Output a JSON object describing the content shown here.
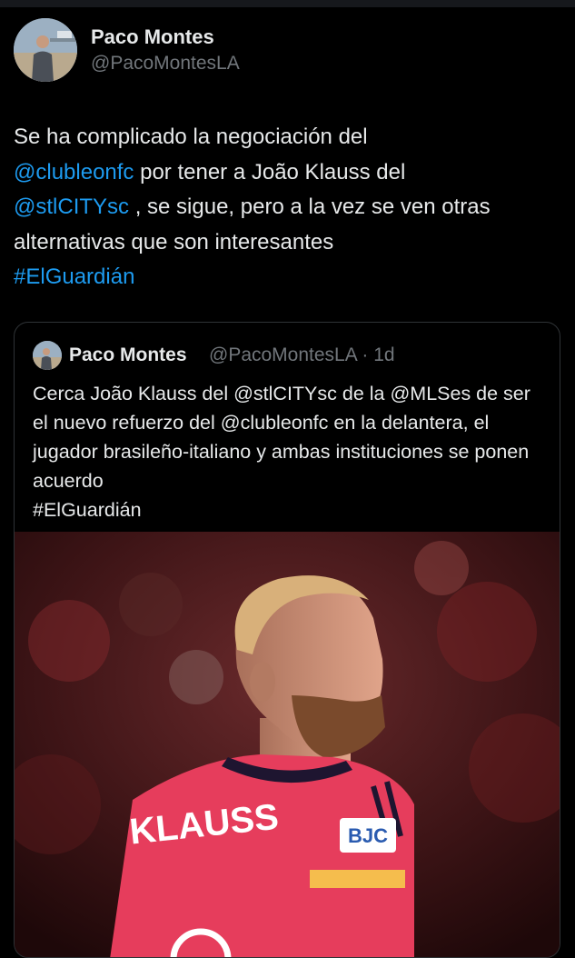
{
  "tweet": {
    "author": {
      "name": "Paco Montes",
      "handle": "@PacoMontesLA"
    },
    "text": {
      "line1": "Se ha complicado la negociación del",
      "mention1": "@clubleonfc",
      "part2": " por tener a João Klauss del",
      "mention2": "@stlCITYsc",
      "part3": " , se sigue, pero a la vez se ven otras alternativas que son interesantes",
      "hashtag": "#ElGuardián"
    }
  },
  "quoted": {
    "author": {
      "name": "Paco Montes",
      "handle_time": "@PacoMontesLA · 1d"
    },
    "text": "Cerca João Klauss del @stlCITYsc de la @MLSes de ser el nuevo refuerzo del @clubleonfc en la delantera, el jugador brasileño-italiano y ambas instituciones se ponen acuerdo",
    "hashtag": "#ElGuardián",
    "media": {
      "jersey_name": "KLAUSS",
      "sponsor": "BJC"
    }
  },
  "colors": {
    "background": "#000000",
    "text": "#e7e9ea",
    "secondary": "#71767b",
    "link": "#1d9bf0",
    "border": "#2f3336",
    "jersey": "#e63d5c"
  }
}
